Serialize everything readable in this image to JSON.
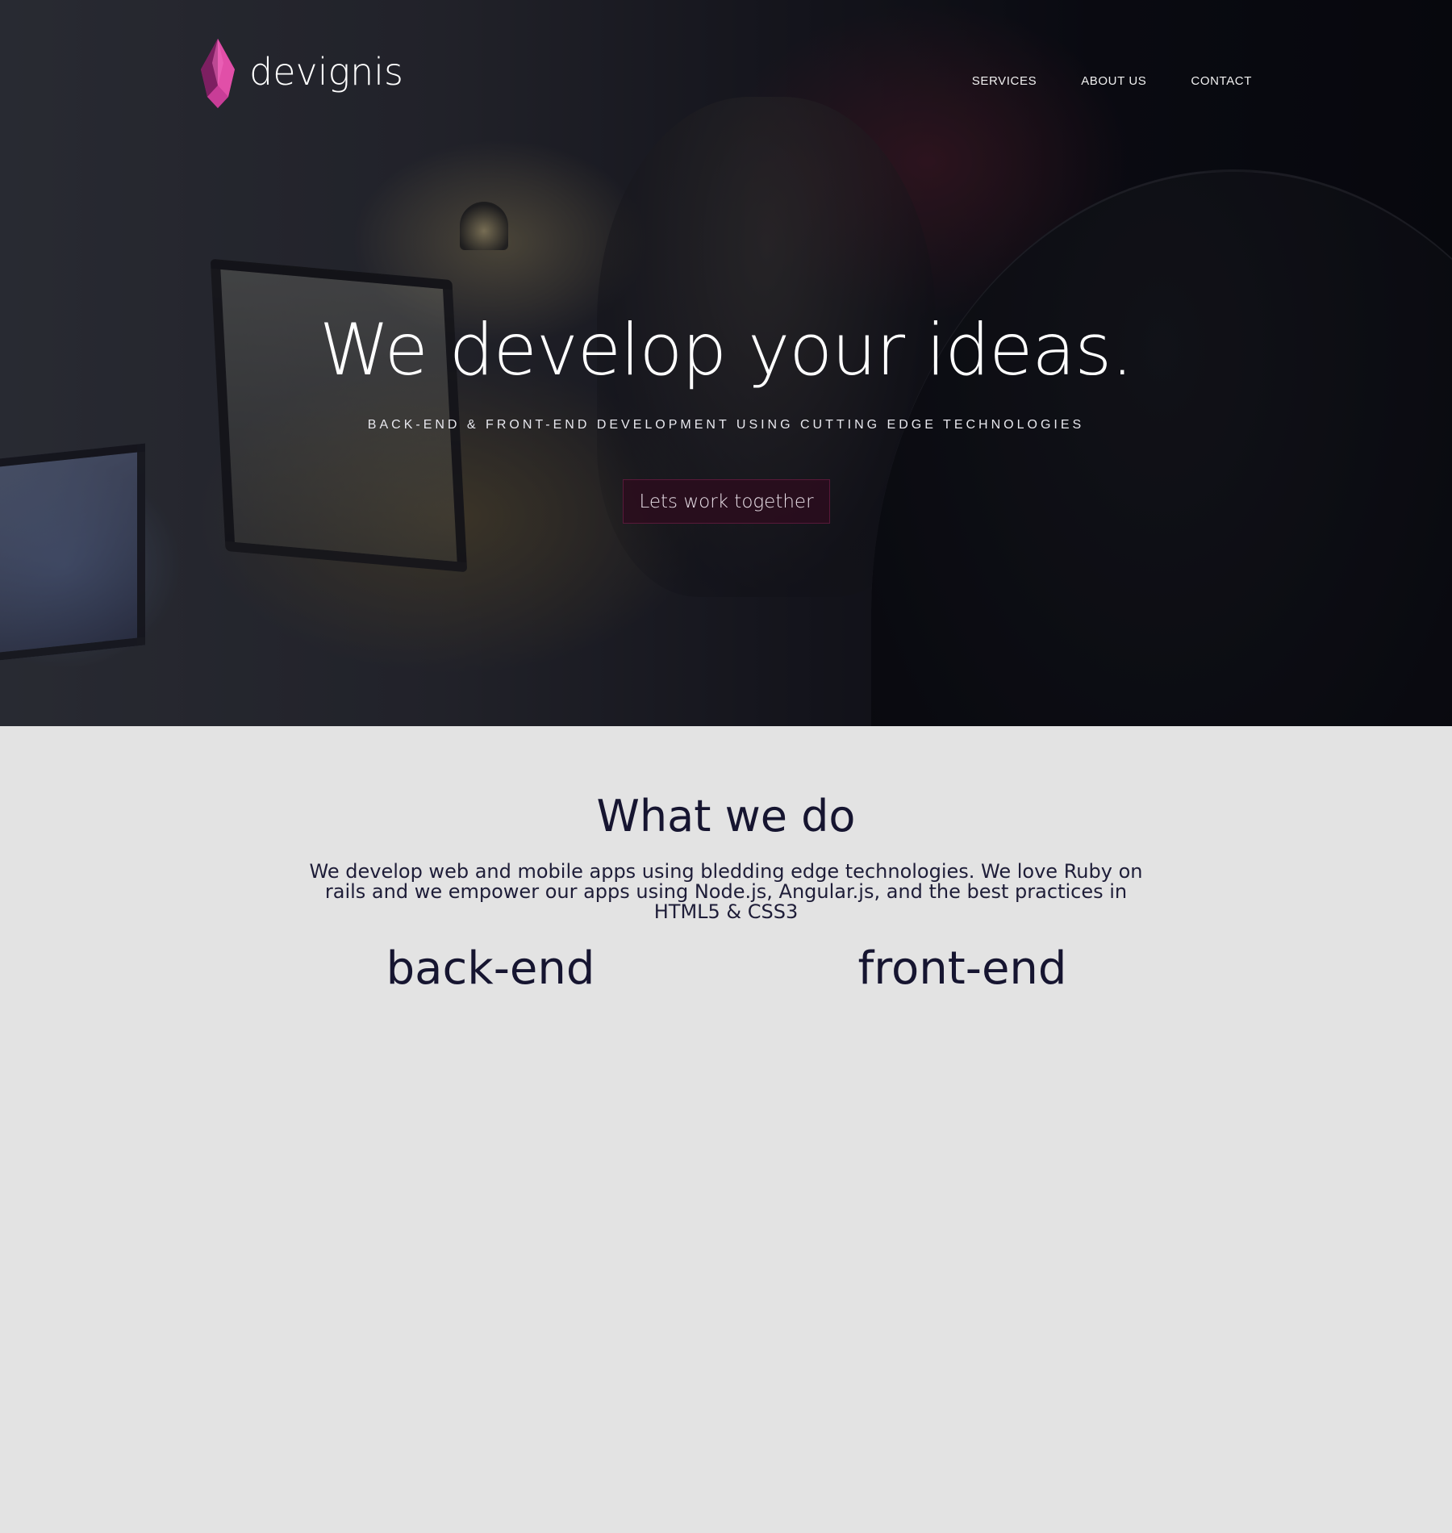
{
  "brand": {
    "name": "devignis",
    "logo_colors": [
      "#e14fa8",
      "#b32a85",
      "#7d1f61"
    ]
  },
  "nav": {
    "items": [
      {
        "label": "SERVICES"
      },
      {
        "label": "ABOUT US"
      },
      {
        "label": "CONTACT"
      }
    ]
  },
  "hero": {
    "title": "We develop your ideas.",
    "subtitle": "BACK-END & FRONT-END DEVELOPMENT USING CUTTING EDGE TECHNOLOGIES",
    "cta_label": "Lets work together"
  },
  "what_we_do": {
    "title": "What we do",
    "text": "We develop web and mobile apps using bledding edge technologies. We love Ruby on rails and we empower our apps using Node.js, Angular.js, and the best practices in HTML5 & CSS3",
    "columns": [
      {
        "title": "back-end"
      },
      {
        "title": "front-end"
      }
    ]
  },
  "colors": {
    "accent": "#c2348f",
    "cta_background": "#2d0c1e",
    "section_background": "#e3e3e3",
    "heading_text": "#161530"
  }
}
